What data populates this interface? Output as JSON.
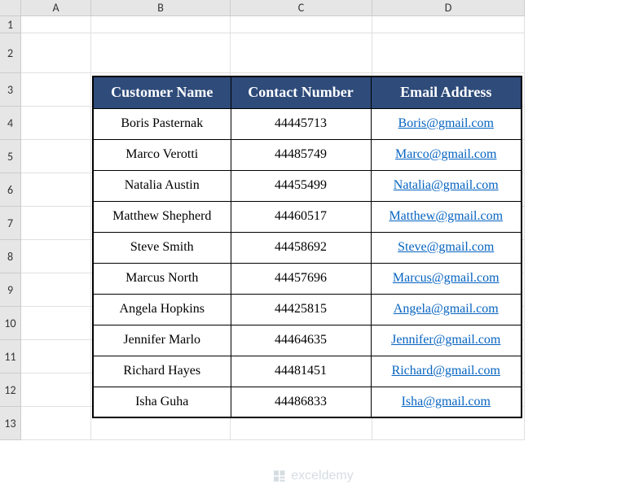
{
  "columns": [
    "A",
    "B",
    "C",
    "D"
  ],
  "rows": [
    "1",
    "2",
    "3",
    "4",
    "5",
    "6",
    "7",
    "8",
    "9",
    "10",
    "11",
    "12",
    "13"
  ],
  "table": {
    "headers": {
      "name": "Customer Name",
      "contact": "Contact Number",
      "email": "Email Address"
    },
    "data": [
      {
        "name": "Boris Pasternak",
        "contact": "44445713",
        "email": "Boris@gmail.com"
      },
      {
        "name": "Marco Verotti",
        "contact": "44485749",
        "email": "Marco@gmail.com"
      },
      {
        "name": "Natalia Austin",
        "contact": "44455499",
        "email": "Natalia@gmail.com"
      },
      {
        "name": "Matthew Shepherd",
        "contact": "44460517",
        "email": "Matthew@gmail.com"
      },
      {
        "name": "Steve Smith",
        "contact": "44458692",
        "email": "Steve@gmail.com"
      },
      {
        "name": "Marcus North",
        "contact": "44457696",
        "email": "Marcus@gmail.com"
      },
      {
        "name": "Angela Hopkins",
        "contact": "44425815",
        "email": "Angela@gmail.com"
      },
      {
        "name": "Jennifer Marlo",
        "contact": "44464635",
        "email": "Jennifer@gmail.com"
      },
      {
        "name": "Richard Hayes",
        "contact": "44481451",
        "email": "Richard@gmail.com"
      },
      {
        "name": "Isha Guha",
        "contact": "44486833",
        "email": "Isha@gmail.com"
      }
    ]
  },
  "watermark": {
    "text": "exceldemy"
  }
}
